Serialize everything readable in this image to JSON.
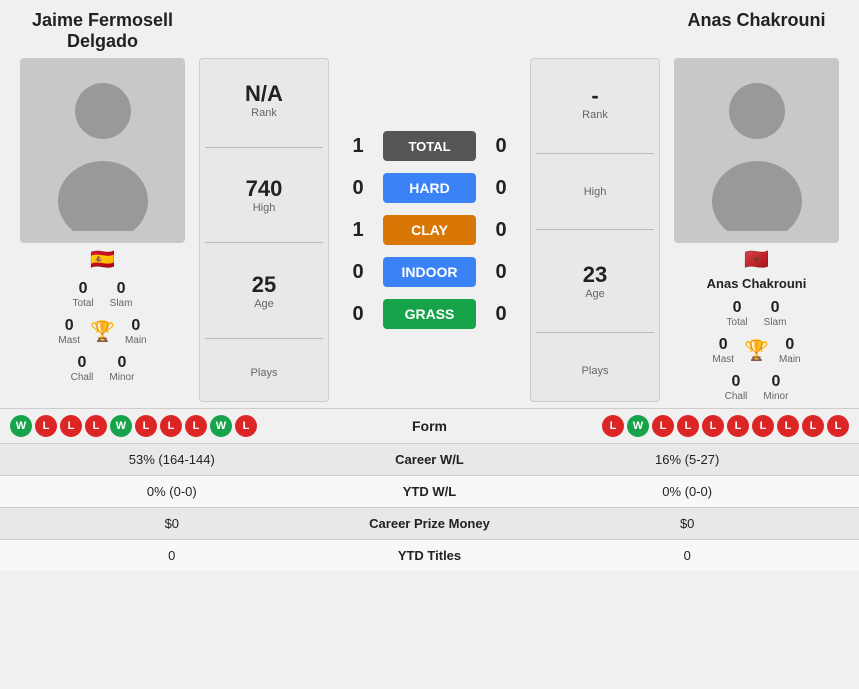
{
  "players": {
    "p1": {
      "name": "Jaime Fermosell Delgado",
      "name_line1": "Jaime Fermosell",
      "name_line2": "Delgado",
      "flag": "🇪🇸",
      "stats": {
        "rank": "N/A",
        "high": "740",
        "age": "25",
        "plays": "Plays"
      },
      "totals": {
        "total": "0",
        "total_label": "Total",
        "slam": "0",
        "slam_label": "Slam",
        "mast": "0",
        "mast_label": "Mast",
        "main": "0",
        "main_label": "Main",
        "chall": "0",
        "chall_label": "Chall",
        "minor": "0",
        "minor_label": "Minor"
      },
      "form": [
        "W",
        "L",
        "L",
        "L",
        "W",
        "L",
        "L",
        "L",
        "W",
        "L"
      ],
      "career_wl": "53% (164-144)",
      "ytd_wl": "0% (0-0)",
      "prize": "$0",
      "titles": "0"
    },
    "p2": {
      "name": "Anas Chakrouni",
      "flag": "🇲🇦",
      "stats": {
        "rank": "-",
        "rank_label": "Rank",
        "high": "High",
        "high_label": "High",
        "age": "23",
        "age_label": "Age",
        "plays": "Plays",
        "plays_label": "Plays"
      },
      "totals": {
        "total": "0",
        "total_label": "Total",
        "slam": "0",
        "slam_label": "Slam",
        "mast": "0",
        "mast_label": "Mast",
        "main": "0",
        "main_label": "Main",
        "chall": "0",
        "chall_label": "Chall",
        "minor": "0",
        "minor_label": "Minor"
      },
      "form": [
        "L",
        "W",
        "L",
        "L",
        "L",
        "L",
        "L",
        "L",
        "L",
        "L"
      ],
      "career_wl": "16% (5-27)",
      "ytd_wl": "0% (0-0)",
      "prize": "$0",
      "titles": "0"
    }
  },
  "scores": {
    "total": {
      "label": "Total",
      "p1": "1",
      "p2": "0"
    },
    "hard": {
      "label": "Hard",
      "p1": "0",
      "p2": "0"
    },
    "clay": {
      "label": "Clay",
      "p1": "1",
      "p2": "0"
    },
    "indoor": {
      "label": "Indoor",
      "p1": "0",
      "p2": "0"
    },
    "grass": {
      "label": "Grass",
      "p1": "0",
      "p2": "0"
    }
  },
  "labels": {
    "form": "Form",
    "career_wl": "Career W/L",
    "ytd_wl": "YTD W/L",
    "prize": "Career Prize Money",
    "titles": "YTD Titles",
    "rank_label": "Rank",
    "high_label": "High",
    "age_label": "Age",
    "plays_label": "Plays"
  }
}
